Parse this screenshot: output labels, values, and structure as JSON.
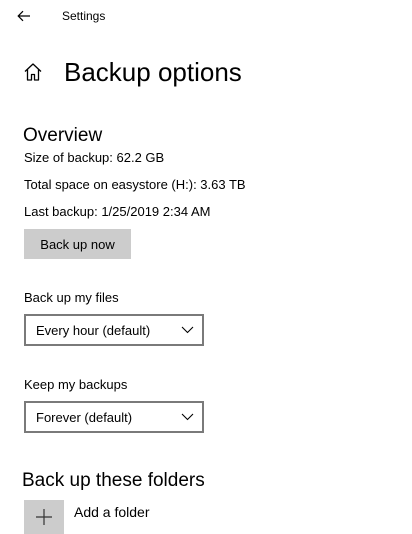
{
  "titlebar": {
    "back_icon": "back-arrow-icon",
    "app_title": "Settings"
  },
  "header": {
    "icon": "home-icon",
    "title": "Backup options"
  },
  "overview": {
    "title": "Overview",
    "size": "Size of backup: 62.2 GB",
    "total_space": "Total space on easystore (H:): 3.63 TB",
    "last_backup": "Last backup: 1/25/2019 2:34 AM",
    "backup_now_label": "Back up now"
  },
  "backup_files": {
    "label": "Back up my files",
    "selected": "Every hour (default)",
    "icon": "chevron-down-icon"
  },
  "keep_backups": {
    "label": "Keep my backups",
    "selected": "Forever (default)",
    "icon": "chevron-down-icon"
  },
  "folders": {
    "title": "Back up these folders",
    "add_label": "Add a folder",
    "add_icon": "plus-icon"
  },
  "colors": {
    "button_bg": "#cccccc",
    "select_border": "#7a7a7a",
    "text": "#000000",
    "background": "#ffffff"
  }
}
